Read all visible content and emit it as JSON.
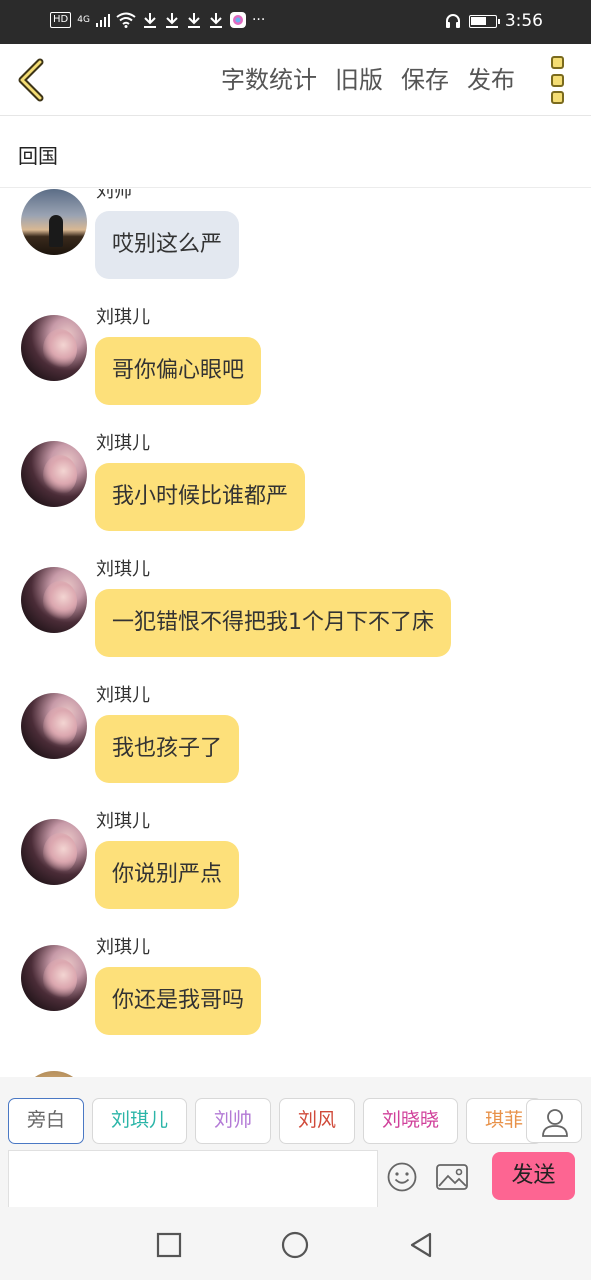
{
  "status_bar": {
    "hd": "HD",
    "network": "4G",
    "more": "···",
    "time": "3:56",
    "battery_level": 0.65,
    "icons": [
      "signal-icon",
      "wifi-icon",
      "download-icon",
      "download-icon",
      "download-icon",
      "download-icon",
      "app-icon",
      "headphone-icon",
      "battery-icon"
    ]
  },
  "toolbar": {
    "back_icon": "chevron-left-icon",
    "actions": [
      "字数统计",
      "旧版",
      "保存",
      "发布"
    ],
    "more_icon": "more-vertical-icon"
  },
  "chapter": {
    "title": "回国"
  },
  "messages": [
    {
      "sender": "刘帅",
      "text": "哎别这么严",
      "style": "gray",
      "avatar": "avatar-man-sunset"
    },
    {
      "sender": "刘琪儿",
      "text": "哥你偏心眼吧",
      "style": "yellow",
      "avatar": "avatar-girl"
    },
    {
      "sender": "刘琪儿",
      "text": "我小时候比谁都严",
      "style": "yellow",
      "avatar": "avatar-girl"
    },
    {
      "sender": "刘琪儿",
      "text": "一犯错恨不得把我1个月下不了床",
      "style": "yellow",
      "avatar": "avatar-girl"
    },
    {
      "sender": "刘琪儿",
      "text": "我也孩子了",
      "style": "yellow",
      "avatar": "avatar-girl"
    },
    {
      "sender": "刘琪儿",
      "text": "你说别严点",
      "style": "yellow",
      "avatar": "avatar-girl"
    },
    {
      "sender": "刘琪儿",
      "text": "你还是我哥吗",
      "style": "yellow",
      "avatar": "avatar-girl"
    }
  ],
  "characters": [
    {
      "label": "旁白",
      "color": "#666666",
      "selected": true
    },
    {
      "label": "刘琪儿",
      "color": "#2bb5a8"
    },
    {
      "label": "刘帅",
      "color": "#b37ad6"
    },
    {
      "label": "刘风",
      "color": "#d04a3a"
    },
    {
      "label": "刘晓晓",
      "color": "#d0409a"
    },
    {
      "label": "琪菲",
      "color": "#e8924a"
    }
  ],
  "input": {
    "placeholder": "",
    "value": "",
    "send_label": "发送"
  },
  "colors": {
    "bubble_yellow": "#fde07a",
    "bubble_gray": "#e3e8f0",
    "send": "#fd6592",
    "accent_icon": "#f4dd74"
  }
}
